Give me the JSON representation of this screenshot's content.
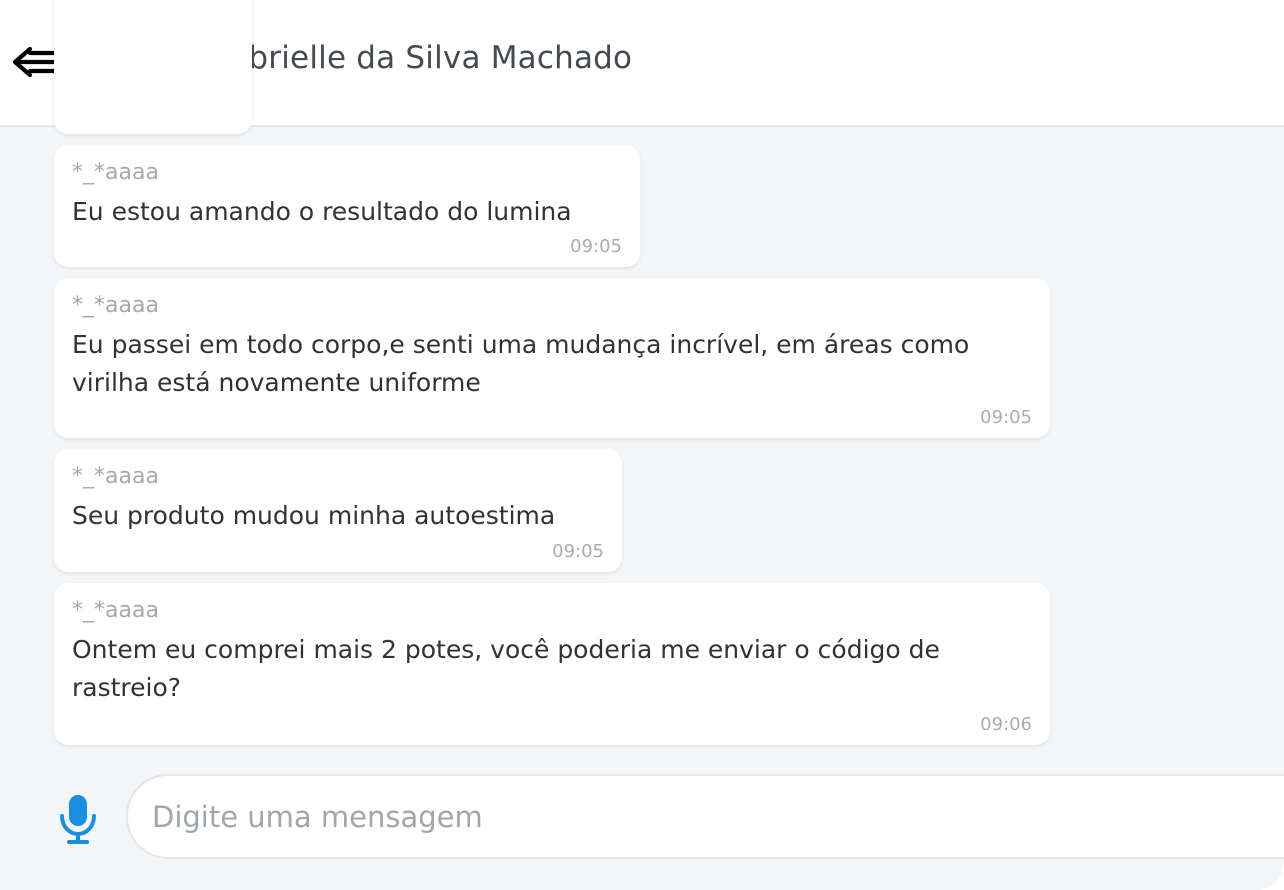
{
  "header": {
    "contact_name": "Gabrielle da Silva Machado",
    "back_icon": "back-arrow-icon"
  },
  "messages": [
    {
      "sender": "*_*aaaa",
      "text": "Eu estou amando o resultado do lumina",
      "time": "09:05"
    },
    {
      "sender": "*_*aaaa",
      "text": "Eu passei em todo corpo,e senti uma mudança incrível, em áreas como virilha está novamente uniforme",
      "time": "09:05"
    },
    {
      "sender": "*_*aaaa",
      "text": "Seu produto mudou minha autoestima",
      "time": "09:05"
    },
    {
      "sender": "*_*aaaa",
      "text": "Ontem eu comprei mais 2 potes, você poderia me enviar o código de rastreio?",
      "time": "09:06"
    }
  ],
  "composer": {
    "placeholder": "Digite uma mensagem",
    "mic_icon": "microphone-icon"
  },
  "colors": {
    "accent": "#1a8fe0",
    "background": "#f4f5f7"
  }
}
